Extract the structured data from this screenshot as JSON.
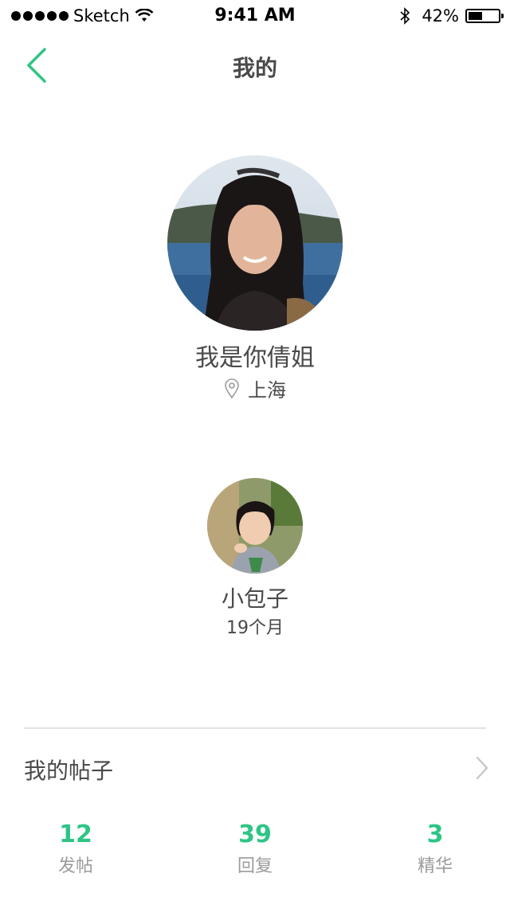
{
  "status_bar": {
    "carrier": "Sketch",
    "time": "9:41 AM",
    "battery": "42%",
    "battery_level": 0.42
  },
  "nav": {
    "title": "我的",
    "back_icon": "chevron-left-icon"
  },
  "profile": {
    "name": "我是你倩姐",
    "location": "上海"
  },
  "child": {
    "name": "小包子",
    "age": "19个月"
  },
  "posts": {
    "label": "我的帖子",
    "stats": [
      {
        "value": "12",
        "label": "发帖"
      },
      {
        "value": "39",
        "label": "回复"
      },
      {
        "value": "3",
        "label": "精华"
      }
    ]
  },
  "colors": {
    "accent": "#2ec584",
    "text": "#4a4a4a",
    "muted": "#9b9b9b",
    "divider": "#e2e2e2"
  }
}
